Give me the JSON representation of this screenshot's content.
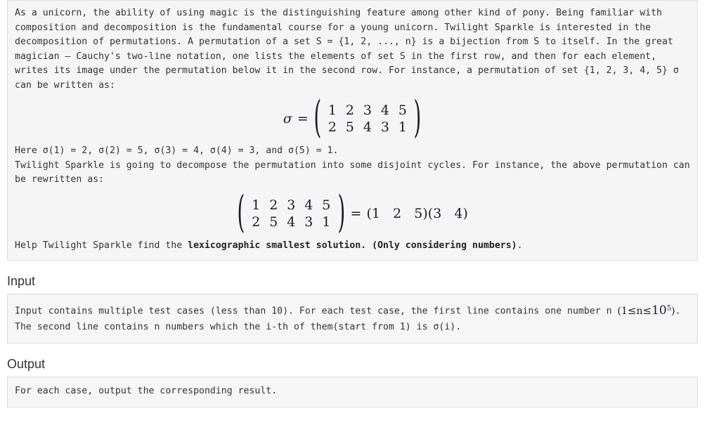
{
  "description": {
    "paragraph1": "As a unicorn, the ability of using magic is the distinguishing feature among other kind of pony. Being familiar with composition and decomposition is the fundamental course for a young unicorn. Twilight Sparkle is interested in the decomposition of permutations. A permutation of a set S = {1, 2, ..., n} is a bijection from S to itself. In the great magician — Cauchy's two-line notation, one lists the elements of set S in the first row, and then for each element, writes its image under the permutation below it in the second row. For instance, a permutation of set {1, 2, 3, 4, 5} σ can be written as:",
    "formula1": {
      "lhs_symbol": "σ",
      "equals": "=",
      "left_paren": "(",
      "right_paren": ")",
      "row_top": [
        "1",
        "2",
        "3",
        "4",
        "5"
      ],
      "row_bottom": [
        "2",
        "5",
        "4",
        "3",
        "1"
      ]
    },
    "paragraph2": "Here σ(1) = 2, σ(2) = 5, σ(3) = 4, σ(4) = 3, and σ(5) = 1.",
    "paragraph3": "Twilight Sparkle is going to decompose the permutation into some disjoint cycles. For instance, the above permutation can be rewritten as:",
    "formula2": {
      "left_paren": "(",
      "right_paren": ")",
      "row_top": [
        "1",
        "2",
        "3",
        "4",
        "5"
      ],
      "row_bottom": [
        "2",
        "5",
        "4",
        "3",
        "1"
      ],
      "equals": "=",
      "cycles": "(1   2   5)(3   4)"
    },
    "paragraph4_prefix": "Help Twilight Sparkle find the ",
    "paragraph4_bold": "lexicographic smallest solution. (Only considering numbers)",
    "paragraph4_suffix": "."
  },
  "input_section": {
    "heading": "Input",
    "line1": "Input contains multiple test cases (less than 10). For each test case, the first line contains one number n",
    "constraint": {
      "open_paren": "(",
      "lower": "1",
      "le1": "≤",
      "var": "n",
      "le2": "≤",
      "base": "10",
      "exponent": "5",
      "close_paren": ")"
    },
    "line2": ". The second line contains n numbers which the i-th of them(start from 1) is σ(i)."
  },
  "output_section": {
    "heading": "Output",
    "line1": "For each case, output the corresponding result."
  },
  "colors": {
    "panel_bg": "#f5f5f5",
    "panel_border": "#dddddd",
    "text": "#333333",
    "math_text": "#1b1b2b",
    "page_bg": "#ffffff"
  }
}
